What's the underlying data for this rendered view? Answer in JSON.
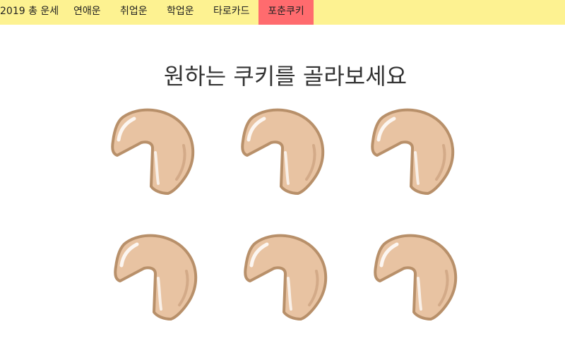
{
  "nav": {
    "items": [
      {
        "label": "2019 총 운세",
        "active": false
      },
      {
        "label": "연애운",
        "active": false
      },
      {
        "label": "취업운",
        "active": false
      },
      {
        "label": "학업운",
        "active": false
      },
      {
        "label": "타로카드",
        "active": false
      },
      {
        "label": "포춘쿠키",
        "active": true
      }
    ],
    "background_color": "#fdf291",
    "active_color": "#ff6b6e"
  },
  "main": {
    "title": "원하는 쿠키를 골라보세요"
  },
  "cookies": {
    "count": 6,
    "icon": "fortune-cookie-icon",
    "fill_color": "#e8c3a2",
    "outline_color": "#b8906a"
  }
}
